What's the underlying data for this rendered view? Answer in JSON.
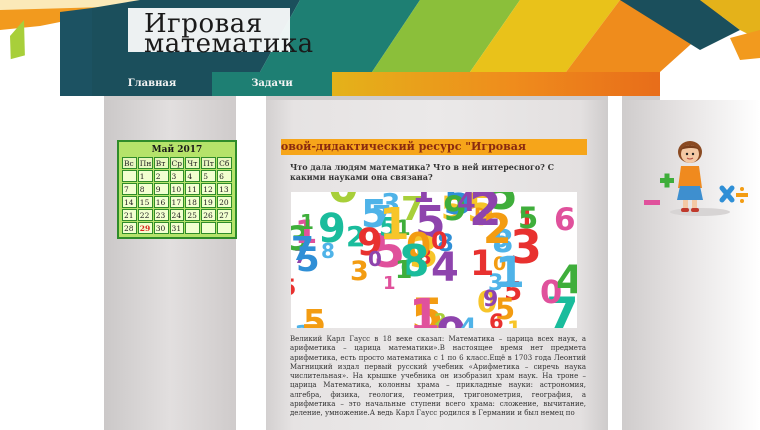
{
  "site": {
    "title_line1": "Игровая",
    "title_line2": "математика"
  },
  "nav": {
    "items": [
      {
        "label": "Главная"
      },
      {
        "label": "Задачи"
      }
    ]
  },
  "calendar": {
    "title": "Май 2017",
    "weekdays": [
      "Вс",
      "Пн",
      "Вт",
      "Ср",
      "Чт",
      "Пт",
      "Сб"
    ],
    "weeks": [
      [
        "",
        "1",
        "2",
        "3",
        "4",
        "5",
        "6"
      ],
      [
        "7",
        "8",
        "9",
        "10",
        "11",
        "12",
        "13"
      ],
      [
        "14",
        "15",
        "16",
        "17",
        "18",
        "19",
        "20"
      ],
      [
        "21",
        "22",
        "23",
        "24",
        "25",
        "26",
        "27"
      ],
      [
        "28",
        "29",
        "30",
        "31",
        "",
        "",
        ""
      ]
    ],
    "today": "29"
  },
  "article": {
    "banner": "Учебно-игровой-дидактический ресурс \"Игровая",
    "question": "Что дала людям математика? Что в ней интересного? С какими науками она связана?",
    "body": "Великий Карл Гаусс в 18 веке сказал: Математика – царица всех наук, а арифметика – царица математики».В настоящее время нет предмета арифметика, есть просто математика с 1 по 6 класс.Ещё в 1703 года Леонтий Магницкий издал первый русский учебник «Арифметика – сиречь наука числительная». На крышке учебника он изобразил храм наук. На троне – царица Математика, колонны храма – прикладные науки: астрономия, алгебра, физика, геология, геометрия, тригонометрия, география, а арифметика – это начальные ступени всего храма: сложение, вычитание, деление, умножение.А ведь Карл Гаусс родился в Германии и был немец по"
  },
  "colors": {
    "nav_home": "#1b4f5c",
    "nav_tasks": "#1e7f73",
    "banner": "#f6a51a",
    "calendar_bg": "#b5e36a",
    "calendar_border": "#2f8c2a",
    "today": "#d8261f"
  }
}
